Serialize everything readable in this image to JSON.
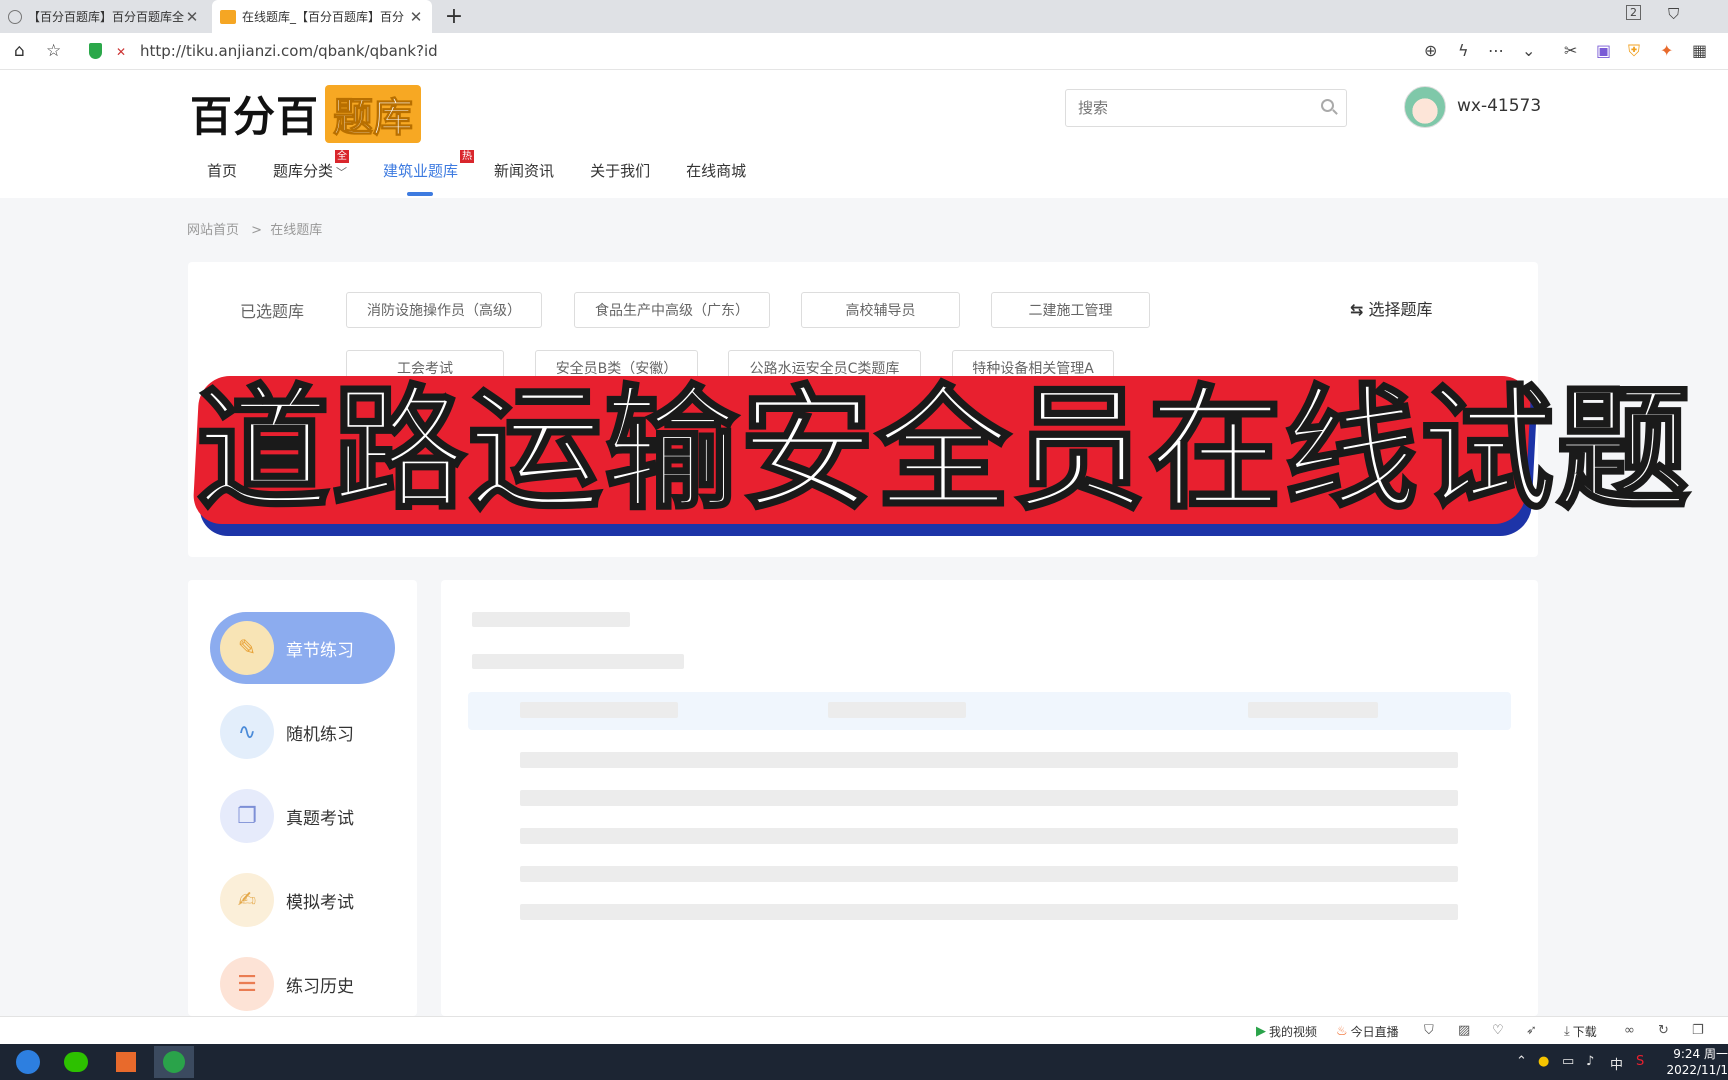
{
  "browser": {
    "tabs": [
      {
        "title": "【百分百题库】百分百题库全",
        "active": false
      },
      {
        "title": "在线题库_【百分百题库】百分",
        "active": true
      }
    ],
    "new_tab": "+",
    "url": "http://tiku.anjianzi.com/qbank/qbank?id",
    "tab_count": "2"
  },
  "site": {
    "logo_part1": "百分百",
    "logo_part2": "题库",
    "search_placeholder": "搜索",
    "username": "wx-41573",
    "nav": [
      {
        "label": "首页",
        "badge": ""
      },
      {
        "label": "题库分类",
        "badge": "全"
      },
      {
        "label": "建筑业题库",
        "badge": "热"
      },
      {
        "label": "新闻资讯",
        "badge": ""
      },
      {
        "label": "关于我们",
        "badge": ""
      },
      {
        "label": "在线商城",
        "badge": ""
      }
    ],
    "active_nav": "建筑业题库"
  },
  "breadcrumb": {
    "home": "网站首页",
    "sep": ">",
    "current": "在线题库"
  },
  "selected": {
    "label": "已选题库",
    "switch_label": "选择题库",
    "chips": [
      "消防设施操作员（高级）",
      "食品生产中高级（广东）",
      "高校辅导员",
      "二建施工管理",
      "工会考试",
      "安全员B类（安徽）",
      "公路水运安全员C类题库",
      "特种设备相关管理A"
    ]
  },
  "banner": {
    "text": "道路运输安全员在线试题"
  },
  "sidebar": {
    "items": [
      {
        "label": "章节练习",
        "icon": "pencil-icon",
        "color": "#f8e4b5"
      },
      {
        "label": "随机练习",
        "icon": "pulse-icon",
        "color": "#e3eefb"
      },
      {
        "label": "真题考试",
        "icon": "book-icon",
        "color": "#e6ebfb"
      },
      {
        "label": "模拟考试",
        "icon": "edit-doc-icon",
        "color": "#fbefd9"
      },
      {
        "label": "练习历史",
        "icon": "history-icon",
        "color": "#fde3d6"
      }
    ]
  },
  "statusbar": {
    "my_video": "我的视频",
    "live_today": "今日直播",
    "download": "下载"
  },
  "taskbar": {
    "ime": "中",
    "time": "9:24 周一",
    "date": "2022/11/1"
  },
  "colors": {
    "accent": "#3e7be0",
    "banner_red": "#e8202f",
    "banner_blue": "#1d34a8",
    "logo_orange": "#f7a823"
  }
}
